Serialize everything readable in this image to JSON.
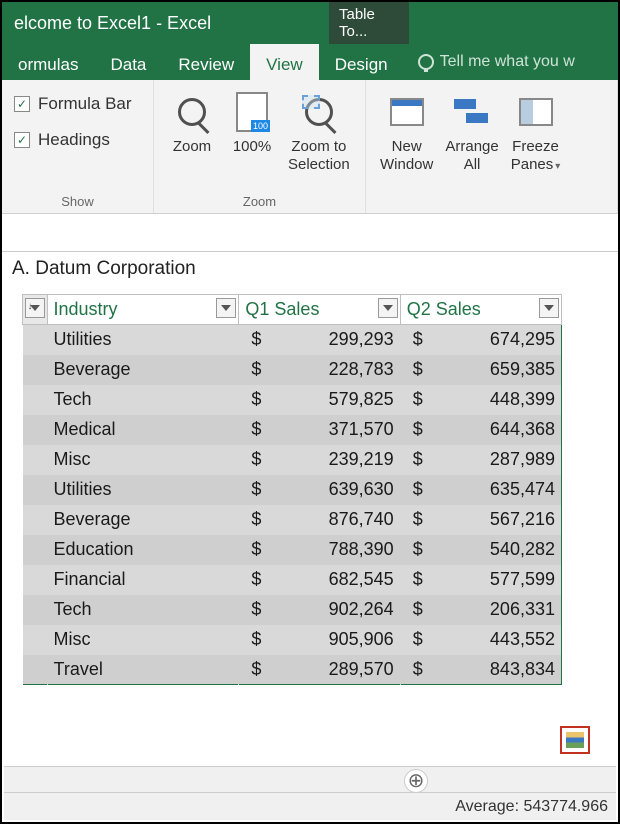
{
  "title": "elcome to Excel1 - Excel",
  "contextual_tab": "Table To...",
  "tabs": {
    "formulas": "ormulas",
    "data": "Data",
    "review": "Review",
    "view": "View",
    "design": "Design"
  },
  "tellme": "Tell me what you w",
  "ribbon": {
    "show": {
      "formula_bar": "Formula Bar",
      "headings": "Headings",
      "group_label": "Show"
    },
    "zoom": {
      "zoom": "Zoom",
      "hundred": "100%",
      "selection_l1": "Zoom to",
      "selection_l2": "Selection",
      "group_label": "Zoom"
    },
    "window": {
      "new_l1": "New",
      "new_l2": "Window",
      "arrange_l1": "Arrange",
      "arrange_l2": "All",
      "freeze_l1": "Freeze",
      "freeze_l2": "Panes"
    }
  },
  "cell_title": "A. Datum Corporation",
  "headers": {
    "industry": "Industry",
    "q1": "Q1 Sales",
    "q2": "Q2 Sales"
  },
  "rows": [
    {
      "industry": "Utilities",
      "q1": "299,293",
      "q2": "674,295"
    },
    {
      "industry": "Beverage",
      "q1": "228,783",
      "q2": "659,385"
    },
    {
      "industry": "Tech",
      "q1": "579,825",
      "q2": "448,399"
    },
    {
      "industry": "Medical",
      "q1": "371,570",
      "q2": "644,368"
    },
    {
      "industry": "Misc",
      "q1": "239,219",
      "q2": "287,989"
    },
    {
      "industry": "Utilities",
      "q1": "639,630",
      "q2": "635,474"
    },
    {
      "industry": "Beverage",
      "q1": "876,740",
      "q2": "567,216"
    },
    {
      "industry": "Education",
      "q1": "788,390",
      "q2": "540,282"
    },
    {
      "industry": "Financial",
      "q1": "682,545",
      "q2": "577,599"
    },
    {
      "industry": "Tech",
      "q1": "902,264",
      "q2": "206,331"
    },
    {
      "industry": "Misc",
      "q1": "905,906",
      "q2": "443,552"
    },
    {
      "industry": "Travel",
      "q1": "289,570",
      "q2": "843,834"
    }
  ],
  "currency": "$",
  "status": {
    "average_label": "Average:",
    "average_value": "543774.966"
  }
}
